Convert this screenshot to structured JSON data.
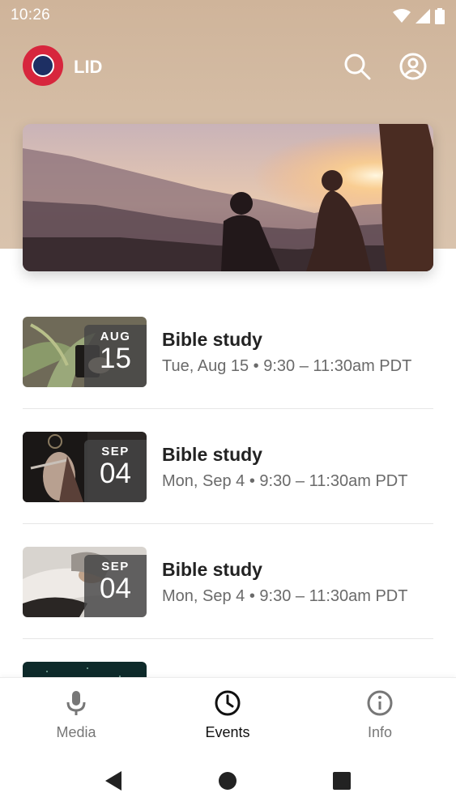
{
  "status_bar": {
    "time": "10:26"
  },
  "header": {
    "app_name": "LID",
    "search_icon": "search-icon",
    "account_icon": "account-icon"
  },
  "events": [
    {
      "month": "AUG",
      "day": "15",
      "title": "Bible study",
      "time": "Tue, Aug 15 • 9:30 – 11:30am PDT"
    },
    {
      "month": "SEP",
      "day": "04",
      "title": "Bible study",
      "time": "Mon, Sep 4 • 9:30 – 11:30am PDT"
    },
    {
      "month": "SEP",
      "day": "04",
      "title": "Bible study",
      "time": "Mon, Sep 4 • 9:30 – 11:30am PDT"
    }
  ],
  "bottom_nav": [
    {
      "label": "Media",
      "icon": "microphone-icon",
      "active": false
    },
    {
      "label": "Events",
      "icon": "clock-icon",
      "active": true
    },
    {
      "label": "Info",
      "icon": "info-icon",
      "active": false
    }
  ],
  "colors": {
    "header_bg": "#cfb49a",
    "avatar": "#d7263d",
    "active": "#111111",
    "inactive": "#777777"
  }
}
